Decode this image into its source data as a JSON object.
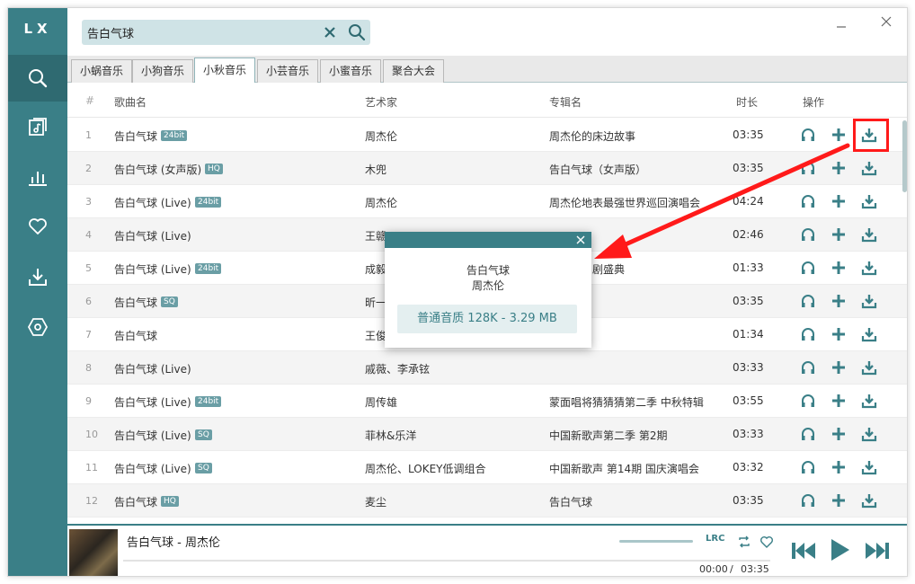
{
  "app": {
    "logo": "LX"
  },
  "colors": {
    "accent": "#3a7f87",
    "highlight": "#ff1a1a"
  },
  "sidebar": [
    {
      "name": "search-icon",
      "active": true
    },
    {
      "name": "playlist-icon"
    },
    {
      "name": "chart-icon"
    },
    {
      "name": "heart-icon"
    },
    {
      "name": "download-icon"
    },
    {
      "name": "settings-icon"
    }
  ],
  "search": {
    "value": "告白气球",
    "placeholder": ""
  },
  "source_tabs": [
    "小蜗音乐",
    "小狗音乐",
    "小秋音乐",
    "小芸音乐",
    "小蜜音乐",
    "聚合大会"
  ],
  "active_source": 2,
  "table": {
    "headers": {
      "num": "#",
      "title": "歌曲名",
      "artist": "艺术家",
      "album": "专辑名",
      "duration": "时长",
      "actions": "操作"
    },
    "rows": [
      {
        "num": "1",
        "title": "告白气球",
        "badge": "24bit",
        "artist": "周杰伦",
        "album": "周杰伦的床边故事",
        "duration": "03:35"
      },
      {
        "num": "2",
        "title": "告白气球 (女声版)",
        "badge": "HQ",
        "artist": "木兜",
        "album": "告白气球（女声版）",
        "duration": "03:35"
      },
      {
        "num": "3",
        "title": "告白气球 (Live)",
        "badge": "24bit",
        "artist": "周杰伦",
        "album": "周杰伦地表最强世界巡回演唱会",
        "duration": "04:24"
      },
      {
        "num": "4",
        "title": "告白气球 (Live)",
        "badge": "",
        "artist": "王赣",
        "album": "",
        "duration": "02:46"
      },
      {
        "num": "5",
        "title": "告白气球 (Live)",
        "badge": "24bit",
        "artist": "成毅",
        "album": "故卫视国剧盛典",
        "duration": "01:33"
      },
      {
        "num": "6",
        "title": "告白气球",
        "badge": "SQ",
        "artist": "昕一",
        "album": "",
        "duration": "03:35"
      },
      {
        "num": "7",
        "title": "告白气球",
        "badge": "",
        "artist": "王俊",
        "album": "",
        "duration": "01:34"
      },
      {
        "num": "8",
        "title": "告白气球 (Live)",
        "badge": "",
        "artist": "戚薇、李承铉",
        "album": "",
        "duration": "03:33"
      },
      {
        "num": "9",
        "title": "告白气球 (Live)",
        "badge": "24bit",
        "artist": "周传雄",
        "album": "蒙面唱将猜猜猜第二季 中秋特辑",
        "duration": "03:55"
      },
      {
        "num": "10",
        "title": "告白气球 (Live)",
        "badge": "SQ",
        "artist": "菲林&乐洋",
        "album": "中国新歌声第二季 第2期",
        "duration": "03:33"
      },
      {
        "num": "11",
        "title": "告白气球 (Live)",
        "badge": "SQ",
        "artist": "周杰伦、LOKEY低调组合",
        "album": "中国新歌声 第14期 国庆演唱会",
        "duration": "03:32"
      },
      {
        "num": "12",
        "title": "告白气球",
        "badge": "HQ",
        "artist": "麦尘",
        "album": "告白气球",
        "duration": "03:35"
      }
    ]
  },
  "dialog": {
    "title": "告白气球",
    "artist": "周杰伦",
    "option": "普通音质 128K - 3.29 MB"
  },
  "player": {
    "title": "告白气球 - 周杰伦",
    "time_current": "00:00",
    "time_sep": "/",
    "time_total": "03:35",
    "lyrics_label": "LRC"
  }
}
